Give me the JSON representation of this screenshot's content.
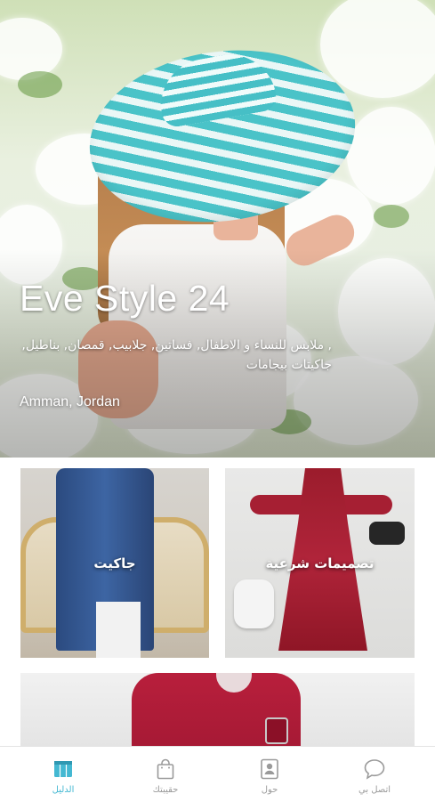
{
  "hero": {
    "title": "Eve Style 24",
    "description": ", ملابس للنساء و الاطفال, فساتين, جلابيب, قمصان, بناطيل, جاكيتات بيجامات",
    "location": "Amman, Jordan"
  },
  "categories": [
    {
      "label": "تصميمات شرعية"
    },
    {
      "label": "جاكيت"
    },
    {
      "label": ""
    }
  ],
  "tabbar": {
    "active_color": "#44b8d2",
    "inactive_color": "#9a9a9a",
    "tabs": [
      {
        "label": "الدليل",
        "icon": "directory-icon",
        "active": true
      },
      {
        "label": "حقيبتك",
        "icon": "shopping-bag-icon",
        "active": false
      },
      {
        "label": "حول",
        "icon": "contact-card-icon",
        "active": false
      },
      {
        "label": "اتصل بي",
        "icon": "chat-bubble-icon",
        "active": false
      }
    ]
  }
}
